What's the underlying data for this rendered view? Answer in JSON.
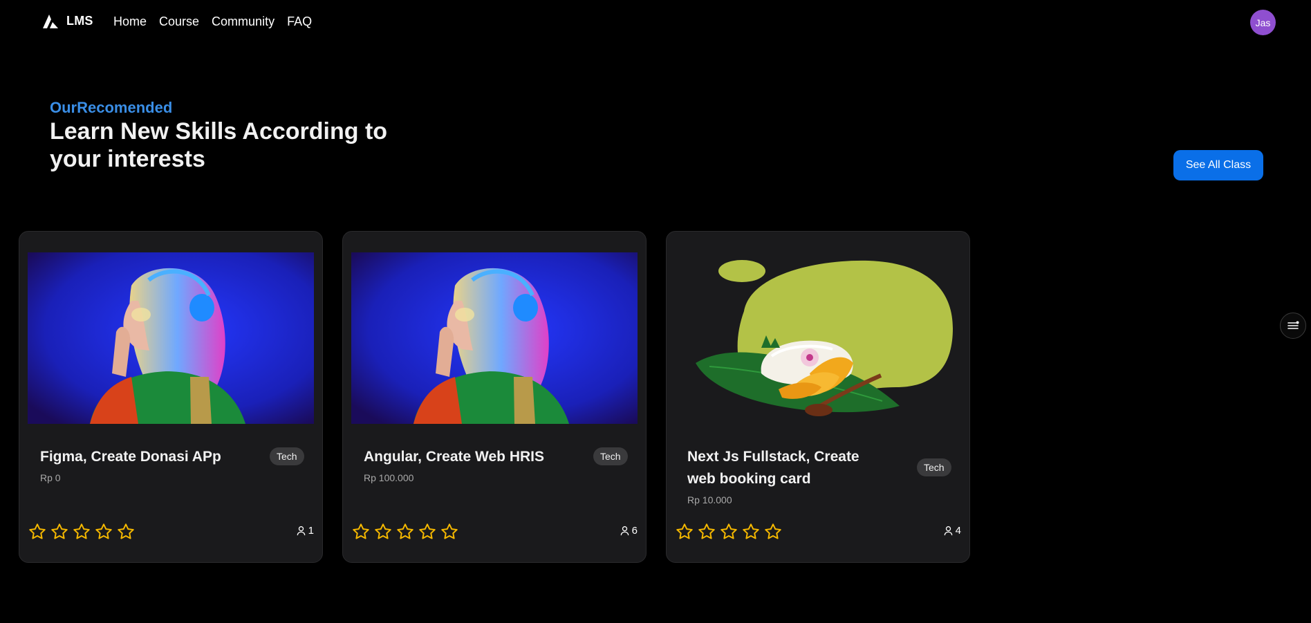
{
  "nav": {
    "brand": "LMS",
    "links": [
      "Home",
      "Course",
      "Community",
      "FAQ"
    ],
    "avatar_initials": "Jas"
  },
  "hero": {
    "eyebrow": "OurRecomended",
    "headline": "Learn New Skills According to your interests",
    "cta": "See All Class"
  },
  "colors": {
    "accent": "#0a6fe8",
    "eyebrow": "#3a8ee6",
    "star": "#f5b800",
    "avatar": "#8f4fd0"
  },
  "courses": [
    {
      "title": "Figma, Create Donasi APp",
      "price": "Rp 0",
      "tag": "Tech",
      "students": "1",
      "image": "woman-with-headphones-photo"
    },
    {
      "title": "Angular, Create Web HRIS",
      "price": "Rp 100.000",
      "tag": "Tech",
      "students": "6",
      "image": "woman-with-headphones-photo"
    },
    {
      "title": "Next Js Fullstack, Create web booking card",
      "price": "Rp 10.000",
      "tag": "Tech",
      "students": "4",
      "image": "mango-sticky-rice-illustration"
    }
  ]
}
